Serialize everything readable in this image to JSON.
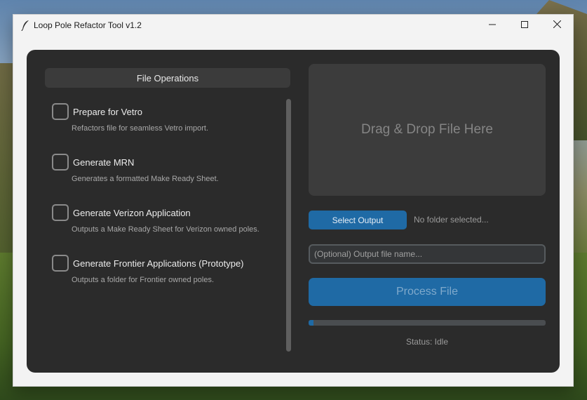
{
  "window": {
    "title": "Loop Pole Refactor Tool v1.2",
    "app_icon": "feather-quill-icon",
    "controls": [
      "minimize-icon",
      "maximize-icon",
      "close-icon"
    ]
  },
  "left_panel": {
    "header": "File Operations",
    "operations": [
      {
        "label": "Prepare for Vetro",
        "description": "Refactors file for seamless Vetro import.",
        "checked": false
      },
      {
        "label": "Generate MRN",
        "description": "Generates a formatted Make Ready Sheet.",
        "checked": false
      },
      {
        "label": "Generate Verizon Application",
        "description": "Outputs a Make Ready Sheet for Verizon owned poles.",
        "checked": false
      },
      {
        "label": "Generate Frontier Applications (Prototype)",
        "description": "Outputs a folder for Frontier owned poles.",
        "checked": false
      }
    ]
  },
  "right_panel": {
    "drop_zone_text": "Drag & Drop File Here",
    "select_output_label": "Select Output",
    "output_folder_text": "No folder selected...",
    "filename_placeholder": "(Optional) Output file name...",
    "filename_value": "",
    "process_button_label": "Process File",
    "progress": 0.02,
    "status": "Status: Idle"
  },
  "colors": {
    "accent": "#1f6aa5",
    "panel_bg": "#2b2b2b",
    "card_bg": "#3c3c3c"
  }
}
